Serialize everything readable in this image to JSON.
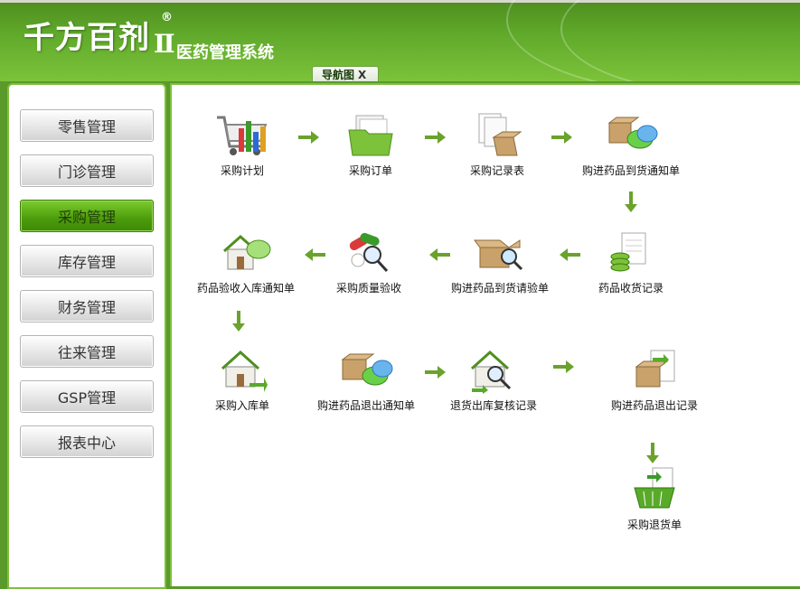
{
  "header": {
    "logo_text": "千方百剂",
    "logo_roman": "Ⅱ",
    "logo_reg": "®",
    "app_subtitle": "医药管理系统",
    "tab_label": "导航图",
    "tab_close": "X"
  },
  "sidebar": {
    "items": [
      {
        "label": "零售管理"
      },
      {
        "label": "门诊管理"
      },
      {
        "label": "采购管理",
        "active": true
      },
      {
        "label": "库存管理"
      },
      {
        "label": "财务管理"
      },
      {
        "label": "往来管理"
      },
      {
        "label": "GSP管理"
      },
      {
        "label": "报表中心"
      }
    ]
  },
  "flow": {
    "nodes": [
      {
        "label": "采购计划",
        "icon": "shopping-cart-chart-icon"
      },
      {
        "label": "采购订单",
        "icon": "folder-documents-icon"
      },
      {
        "label": "采购记录表",
        "icon": "documents-box-icon"
      },
      {
        "label": "购进药品到货通知单",
        "icon": "box-chat-icon"
      },
      {
        "label": "药品收货记录",
        "icon": "document-coins-icon"
      },
      {
        "label": "购进药品到货请验单",
        "icon": "open-box-magnifier-icon"
      },
      {
        "label": "采购质量验收",
        "icon": "pills-magnifier-icon"
      },
      {
        "label": "药品验收入库通知单",
        "icon": "house-chat-icon"
      },
      {
        "label": "采购入库单",
        "icon": "house-arrow-icon"
      },
      {
        "label": "购进药品退出通知单",
        "icon": "box-chat-icon"
      },
      {
        "label": "退货出库复核记录",
        "icon": "house-magnifier-icon"
      },
      {
        "label": "购进药品退出记录",
        "icon": "document-box-arrow-icon"
      },
      {
        "label": "采购退货单",
        "icon": "basket-document-icon"
      }
    ]
  },
  "colors": {
    "header_green": "#5fa82a",
    "active_button": "#4c9b0c",
    "border_green": "#7fbf3f",
    "arrow_green": "#6aa22c"
  }
}
